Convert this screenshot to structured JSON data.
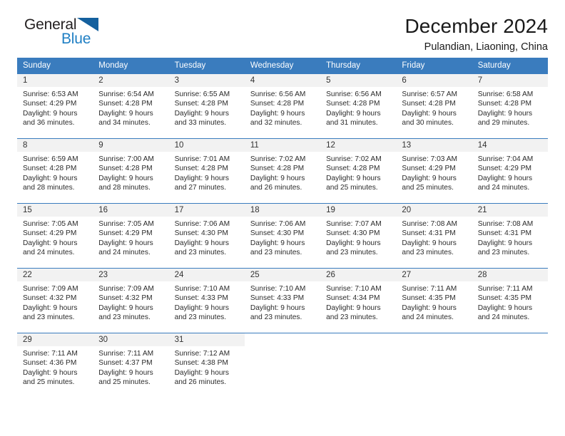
{
  "brand": {
    "word_one": "General",
    "word_two": "Blue",
    "triangle_color": "#14609e",
    "blue_color": "#1f7fc4"
  },
  "header": {
    "title": "December 2024",
    "subtitle": "Pulandian, Liaoning, China"
  },
  "theme": {
    "header_row_bg": "#3a7cbe",
    "daynum_bg": "#f2f2f2",
    "text_color": "#2b2b2b"
  },
  "weekday_headers": [
    "Sunday",
    "Monday",
    "Tuesday",
    "Wednesday",
    "Thursday",
    "Friday",
    "Saturday"
  ],
  "weeks": [
    [
      {
        "day": "1",
        "sunrise": "Sunrise: 6:53 AM",
        "sunset": "Sunset: 4:29 PM",
        "daylight_1": "Daylight: 9 hours",
        "daylight_2": "and 36 minutes."
      },
      {
        "day": "2",
        "sunrise": "Sunrise: 6:54 AM",
        "sunset": "Sunset: 4:28 PM",
        "daylight_1": "Daylight: 9 hours",
        "daylight_2": "and 34 minutes."
      },
      {
        "day": "3",
        "sunrise": "Sunrise: 6:55 AM",
        "sunset": "Sunset: 4:28 PM",
        "daylight_1": "Daylight: 9 hours",
        "daylight_2": "and 33 minutes."
      },
      {
        "day": "4",
        "sunrise": "Sunrise: 6:56 AM",
        "sunset": "Sunset: 4:28 PM",
        "daylight_1": "Daylight: 9 hours",
        "daylight_2": "and 32 minutes."
      },
      {
        "day": "5",
        "sunrise": "Sunrise: 6:56 AM",
        "sunset": "Sunset: 4:28 PM",
        "daylight_1": "Daylight: 9 hours",
        "daylight_2": "and 31 minutes."
      },
      {
        "day": "6",
        "sunrise": "Sunrise: 6:57 AM",
        "sunset": "Sunset: 4:28 PM",
        "daylight_1": "Daylight: 9 hours",
        "daylight_2": "and 30 minutes."
      },
      {
        "day": "7",
        "sunrise": "Sunrise: 6:58 AM",
        "sunset": "Sunset: 4:28 PM",
        "daylight_1": "Daylight: 9 hours",
        "daylight_2": "and 29 minutes."
      }
    ],
    [
      {
        "day": "8",
        "sunrise": "Sunrise: 6:59 AM",
        "sunset": "Sunset: 4:28 PM",
        "daylight_1": "Daylight: 9 hours",
        "daylight_2": "and 28 minutes."
      },
      {
        "day": "9",
        "sunrise": "Sunrise: 7:00 AM",
        "sunset": "Sunset: 4:28 PM",
        "daylight_1": "Daylight: 9 hours",
        "daylight_2": "and 28 minutes."
      },
      {
        "day": "10",
        "sunrise": "Sunrise: 7:01 AM",
        "sunset": "Sunset: 4:28 PM",
        "daylight_1": "Daylight: 9 hours",
        "daylight_2": "and 27 minutes."
      },
      {
        "day": "11",
        "sunrise": "Sunrise: 7:02 AM",
        "sunset": "Sunset: 4:28 PM",
        "daylight_1": "Daylight: 9 hours",
        "daylight_2": "and 26 minutes."
      },
      {
        "day": "12",
        "sunrise": "Sunrise: 7:02 AM",
        "sunset": "Sunset: 4:28 PM",
        "daylight_1": "Daylight: 9 hours",
        "daylight_2": "and 25 minutes."
      },
      {
        "day": "13",
        "sunrise": "Sunrise: 7:03 AM",
        "sunset": "Sunset: 4:29 PM",
        "daylight_1": "Daylight: 9 hours",
        "daylight_2": "and 25 minutes."
      },
      {
        "day": "14",
        "sunrise": "Sunrise: 7:04 AM",
        "sunset": "Sunset: 4:29 PM",
        "daylight_1": "Daylight: 9 hours",
        "daylight_2": "and 24 minutes."
      }
    ],
    [
      {
        "day": "15",
        "sunrise": "Sunrise: 7:05 AM",
        "sunset": "Sunset: 4:29 PM",
        "daylight_1": "Daylight: 9 hours",
        "daylight_2": "and 24 minutes."
      },
      {
        "day": "16",
        "sunrise": "Sunrise: 7:05 AM",
        "sunset": "Sunset: 4:29 PM",
        "daylight_1": "Daylight: 9 hours",
        "daylight_2": "and 24 minutes."
      },
      {
        "day": "17",
        "sunrise": "Sunrise: 7:06 AM",
        "sunset": "Sunset: 4:30 PM",
        "daylight_1": "Daylight: 9 hours",
        "daylight_2": "and 23 minutes."
      },
      {
        "day": "18",
        "sunrise": "Sunrise: 7:06 AM",
        "sunset": "Sunset: 4:30 PM",
        "daylight_1": "Daylight: 9 hours",
        "daylight_2": "and 23 minutes."
      },
      {
        "day": "19",
        "sunrise": "Sunrise: 7:07 AM",
        "sunset": "Sunset: 4:30 PM",
        "daylight_1": "Daylight: 9 hours",
        "daylight_2": "and 23 minutes."
      },
      {
        "day": "20",
        "sunrise": "Sunrise: 7:08 AM",
        "sunset": "Sunset: 4:31 PM",
        "daylight_1": "Daylight: 9 hours",
        "daylight_2": "and 23 minutes."
      },
      {
        "day": "21",
        "sunrise": "Sunrise: 7:08 AM",
        "sunset": "Sunset: 4:31 PM",
        "daylight_1": "Daylight: 9 hours",
        "daylight_2": "and 23 minutes."
      }
    ],
    [
      {
        "day": "22",
        "sunrise": "Sunrise: 7:09 AM",
        "sunset": "Sunset: 4:32 PM",
        "daylight_1": "Daylight: 9 hours",
        "daylight_2": "and 23 minutes."
      },
      {
        "day": "23",
        "sunrise": "Sunrise: 7:09 AM",
        "sunset": "Sunset: 4:32 PM",
        "daylight_1": "Daylight: 9 hours",
        "daylight_2": "and 23 minutes."
      },
      {
        "day": "24",
        "sunrise": "Sunrise: 7:10 AM",
        "sunset": "Sunset: 4:33 PM",
        "daylight_1": "Daylight: 9 hours",
        "daylight_2": "and 23 minutes."
      },
      {
        "day": "25",
        "sunrise": "Sunrise: 7:10 AM",
        "sunset": "Sunset: 4:33 PM",
        "daylight_1": "Daylight: 9 hours",
        "daylight_2": "and 23 minutes."
      },
      {
        "day": "26",
        "sunrise": "Sunrise: 7:10 AM",
        "sunset": "Sunset: 4:34 PM",
        "daylight_1": "Daylight: 9 hours",
        "daylight_2": "and 23 minutes."
      },
      {
        "day": "27",
        "sunrise": "Sunrise: 7:11 AM",
        "sunset": "Sunset: 4:35 PM",
        "daylight_1": "Daylight: 9 hours",
        "daylight_2": "and 24 minutes."
      },
      {
        "day": "28",
        "sunrise": "Sunrise: 7:11 AM",
        "sunset": "Sunset: 4:35 PM",
        "daylight_1": "Daylight: 9 hours",
        "daylight_2": "and 24 minutes."
      }
    ],
    [
      {
        "day": "29",
        "sunrise": "Sunrise: 7:11 AM",
        "sunset": "Sunset: 4:36 PM",
        "daylight_1": "Daylight: 9 hours",
        "daylight_2": "and 25 minutes."
      },
      {
        "day": "30",
        "sunrise": "Sunrise: 7:11 AM",
        "sunset": "Sunset: 4:37 PM",
        "daylight_1": "Daylight: 9 hours",
        "daylight_2": "and 25 minutes."
      },
      {
        "day": "31",
        "sunrise": "Sunrise: 7:12 AM",
        "sunset": "Sunset: 4:38 PM",
        "daylight_1": "Daylight: 9 hours",
        "daylight_2": "and 26 minutes."
      },
      {
        "day": "",
        "sunrise": "",
        "sunset": "",
        "daylight_1": "",
        "daylight_2": ""
      },
      {
        "day": "",
        "sunrise": "",
        "sunset": "",
        "daylight_1": "",
        "daylight_2": ""
      },
      {
        "day": "",
        "sunrise": "",
        "sunset": "",
        "daylight_1": "",
        "daylight_2": ""
      },
      {
        "day": "",
        "sunrise": "",
        "sunset": "",
        "daylight_1": "",
        "daylight_2": ""
      }
    ]
  ]
}
